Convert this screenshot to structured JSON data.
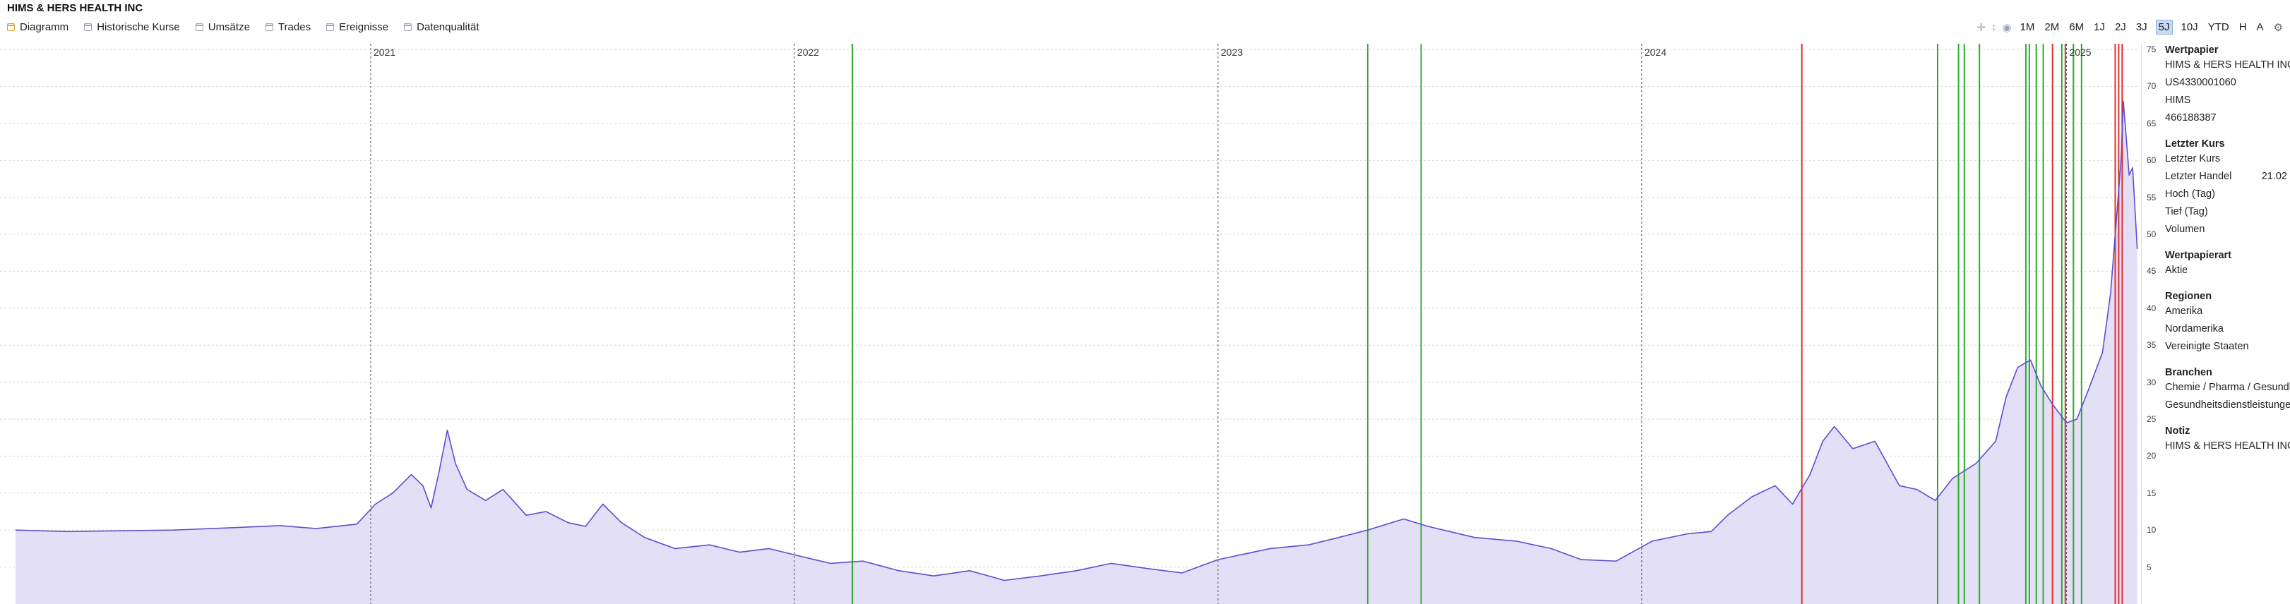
{
  "title": "HIMS & HERS HEALTH INC",
  "tabs": [
    {
      "label": "Diagramm",
      "active": true
    },
    {
      "label": "Historische Kurse",
      "active": false
    },
    {
      "label": "Umsätze",
      "active": false
    },
    {
      "label": "Trades",
      "active": false
    },
    {
      "label": "Ereignisse",
      "active": false
    },
    {
      "label": "Datenqualität",
      "active": false
    }
  ],
  "toolbar": {
    "icons": [
      "crosshair-icon",
      "vertical-measure-icon",
      "eye-icon"
    ],
    "ranges": [
      {
        "label": "1M",
        "active": false
      },
      {
        "label": "2M",
        "active": false
      },
      {
        "label": "6M",
        "active": false
      },
      {
        "label": "1J",
        "active": false
      },
      {
        "label": "2J",
        "active": false
      },
      {
        "label": "3J",
        "active": false
      },
      {
        "label": "5J",
        "active": true
      },
      {
        "label": "10J",
        "active": false
      },
      {
        "label": "YTD",
        "active": false
      },
      {
        "label": "H",
        "active": false
      },
      {
        "label": "A",
        "active": false
      }
    ],
    "settings_icon": "gear-icon"
  },
  "colors": {
    "line": "#5b4fd0",
    "area": "#e3dff6",
    "buy": "#2eaa2e",
    "sell": "#e03030",
    "grid": "#d8d8d8",
    "year_line": "#555555",
    "active_tab": "#e89a2b",
    "active_range": "#c9dbf3"
  },
  "chart_data": {
    "type": "area",
    "ylim": [
      0,
      75
    ],
    "y_ticks": [
      5,
      10,
      15,
      20,
      25,
      30,
      35,
      40,
      45,
      50,
      55,
      60,
      65,
      70,
      75
    ],
    "year_labels": [
      "2021",
      "2022",
      "2023",
      "2024",
      "2025"
    ],
    "x_range": [
      "2020-03-01",
      "2025-03-05"
    ],
    "series": [
      {
        "points": [
          [
            "2020-03-01",
            10.0
          ],
          [
            "2020-04-15",
            9.8
          ],
          [
            "2020-06-01",
            9.9
          ],
          [
            "2020-07-15",
            10.0
          ],
          [
            "2020-09-01",
            10.3
          ],
          [
            "2020-10-15",
            10.6
          ],
          [
            "2020-11-15",
            10.2
          ],
          [
            "2020-12-20",
            10.8
          ],
          [
            "2021-01-05",
            13.5
          ],
          [
            "2021-01-20",
            15.0
          ],
          [
            "2021-02-05",
            17.5
          ],
          [
            "2021-02-15",
            16.0
          ],
          [
            "2021-02-22",
            13.0
          ],
          [
            "2021-03-01",
            18.0
          ],
          [
            "2021-03-08",
            23.5
          ],
          [
            "2021-03-15",
            19.0
          ],
          [
            "2021-03-25",
            15.5
          ],
          [
            "2021-04-10",
            14.0
          ],
          [
            "2021-04-25",
            15.5
          ],
          [
            "2021-05-15",
            12.0
          ],
          [
            "2021-06-01",
            12.5
          ],
          [
            "2021-06-20",
            11.0
          ],
          [
            "2021-07-05",
            10.5
          ],
          [
            "2021-07-20",
            13.5
          ],
          [
            "2021-08-05",
            11.0
          ],
          [
            "2021-08-25",
            9.0
          ],
          [
            "2021-09-20",
            7.5
          ],
          [
            "2021-10-20",
            8.0
          ],
          [
            "2021-11-15",
            7.0
          ],
          [
            "2021-12-10",
            7.5
          ],
          [
            "2022-01-05",
            6.5
          ],
          [
            "2022-02-01",
            5.5
          ],
          [
            "2022-03-01",
            5.8
          ],
          [
            "2022-04-01",
            4.5
          ],
          [
            "2022-05-01",
            3.8
          ],
          [
            "2022-06-01",
            4.5
          ],
          [
            "2022-07-01",
            3.2
          ],
          [
            "2022-08-01",
            3.8
          ],
          [
            "2022-09-01",
            4.5
          ],
          [
            "2022-10-01",
            5.5
          ],
          [
            "2022-11-01",
            4.8
          ],
          [
            "2022-12-01",
            4.2
          ],
          [
            "2023-01-01",
            6.0
          ],
          [
            "2023-02-15",
            7.5
          ],
          [
            "2023-03-20",
            8.0
          ],
          [
            "2023-04-15",
            9.0
          ],
          [
            "2023-05-10",
            10.0
          ],
          [
            "2023-06-10",
            11.5
          ],
          [
            "2023-07-01",
            10.5
          ],
          [
            "2023-08-10",
            9.0
          ],
          [
            "2023-09-15",
            8.5
          ],
          [
            "2023-10-15",
            7.5
          ],
          [
            "2023-11-10",
            6.0
          ],
          [
            "2023-12-10",
            5.8
          ],
          [
            "2024-01-10",
            8.5
          ],
          [
            "2024-02-10",
            9.5
          ],
          [
            "2024-03-01",
            9.8
          ],
          [
            "2024-03-15",
            12.0
          ],
          [
            "2024-04-05",
            14.5
          ],
          [
            "2024-04-25",
            16.0
          ],
          [
            "2024-05-10",
            13.5
          ],
          [
            "2024-05-25",
            17.5
          ],
          [
            "2024-06-05",
            22.0
          ],
          [
            "2024-06-15",
            24.0
          ],
          [
            "2024-07-01",
            21.0
          ],
          [
            "2024-07-20",
            22.0
          ],
          [
            "2024-08-10",
            16.0
          ],
          [
            "2024-08-25",
            15.5
          ],
          [
            "2024-09-10",
            14.0
          ],
          [
            "2024-09-25",
            17.0
          ],
          [
            "2024-10-15",
            19.0
          ],
          [
            "2024-11-01",
            22.0
          ],
          [
            "2024-11-10",
            28.0
          ],
          [
            "2024-11-20",
            32.0
          ],
          [
            "2024-12-01",
            33.0
          ],
          [
            "2024-12-10",
            29.5
          ],
          [
            "2024-12-20",
            27.0
          ],
          [
            "2025-01-01",
            24.5
          ],
          [
            "2025-01-10",
            25.0
          ],
          [
            "2025-01-20",
            29.0
          ],
          [
            "2025-02-01",
            34.0
          ],
          [
            "2025-02-08",
            42.0
          ],
          [
            "2025-02-12",
            50.0
          ],
          [
            "2025-02-17",
            60.0
          ],
          [
            "2025-02-19",
            68.0
          ],
          [
            "2025-02-21",
            64.0
          ],
          [
            "2025-02-24",
            58.0
          ],
          [
            "2025-02-27",
            59.0
          ],
          [
            "2025-03-03",
            48.0
          ]
        ]
      }
    ],
    "buy_markers": [
      "2022-02-20",
      "2023-05-10",
      "2023-06-25",
      "2024-09-12",
      "2024-09-30",
      "2024-10-05",
      "2024-10-18",
      "2024-11-27",
      "2024-11-30",
      "2024-12-06",
      "2024-12-12",
      "2024-12-28",
      "2025-01-07",
      "2025-01-14"
    ],
    "sell_markers": [
      "2024-05-18",
      "2024-12-20",
      "2024-12-31",
      "2025-02-12",
      "2025-02-15",
      "2025-02-18"
    ]
  },
  "panel": {
    "sections": [
      {
        "heading": "Wertpapier",
        "rows": [
          {
            "k": "HIMS & HERS HEALTH INC",
            "v": ""
          },
          {
            "k": "US4330001060",
            "v": ""
          },
          {
            "k": "HIMS",
            "v": ""
          },
          {
            "k": "466188387",
            "v": ""
          }
        ]
      },
      {
        "heading": "Letzter Kurs",
        "rows": [
          {
            "k": "Letzter Kurs",
            "v": ""
          },
          {
            "k": "Letzter Handel",
            "v": "21.02"
          },
          {
            "k": "Hoch (Tag)",
            "v": ""
          },
          {
            "k": "Tief (Tag)",
            "v": ""
          },
          {
            "k": "Volumen",
            "v": ""
          }
        ]
      },
      {
        "heading": "Wertpapierart",
        "rows": [
          {
            "k": "Aktie",
            "v": ""
          }
        ]
      },
      {
        "heading": "Regionen",
        "rows": [
          {
            "k": "Amerika",
            "v": ""
          },
          {
            "k": "Nordamerika",
            "v": ""
          },
          {
            "k": "Vereinigte Staaten",
            "v": ""
          }
        ]
      },
      {
        "heading": "Branchen",
        "rows": [
          {
            "k": "Chemie / Pharma / Gesundheit",
            "v": ""
          },
          {
            "k": "Gesundheitsdienstleistungen",
            "v": ""
          }
        ]
      },
      {
        "heading": "Notiz",
        "rows": [
          {
            "k": "HIMS & HERS HEALTH INC",
            "v": ""
          }
        ]
      }
    ]
  }
}
